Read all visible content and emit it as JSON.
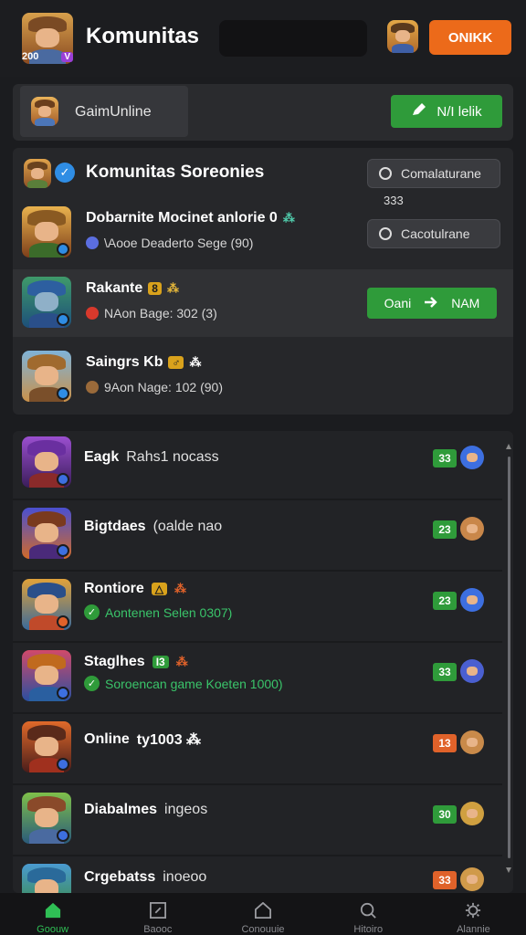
{
  "header": {
    "title": "Komunitas",
    "logo_tag": "200",
    "logo_badge": "V",
    "online_label": "ONIKK"
  },
  "subbar": {
    "label": "GaimUnline",
    "join_label": "N/I lelik"
  },
  "featured": {
    "title": "Komunitas Soreonies",
    "button1": "Comalaturane",
    "between_value": "333",
    "button2": "Cacotulrane",
    "rows": [
      {
        "name": "Dobarnite Mocinet anlorie 0",
        "chip": "",
        "stars": "⁂",
        "stars_color": "teal",
        "sub": "\\Aooe Deaderto Sege (90)",
        "highlighted": false
      },
      {
        "name": "Rakante",
        "chip": "8",
        "stars": "⁂",
        "stars_color": "gold",
        "sub": "NAon Bage: 302 (3)",
        "highlighted": true,
        "cta": "Oani",
        "cta_right": "NAM"
      },
      {
        "name": "Saingrs Kb",
        "chip": "♂",
        "stars": "⁂",
        "stars_color": "white",
        "sub": "9Aon Nage: 102 (90)",
        "highlighted": false
      }
    ]
  },
  "list": {
    "rows": [
      {
        "name": "Eagk",
        "rest": "Rahs1 nocass",
        "sub": "",
        "count": "33",
        "count_color": "#2f9b3a"
      },
      {
        "name": "Bigtdaes",
        "rest": "(oalde nao",
        "sub": "",
        "count": "23",
        "count_color": "#2f9b3a"
      },
      {
        "name": "Rontiore",
        "rest": "",
        "chip": "△",
        "stars": "⁂",
        "sub": "Aontenen Selen 0307)",
        "count": "23",
        "count_color": "#2f9b3a"
      },
      {
        "name": "Staglhes",
        "rest": "",
        "chip": "I3",
        "stars": "⁂",
        "sub": "Soroencan game Koeten 1000)",
        "count": "33",
        "count_color": "#2f9b3a"
      },
      {
        "name": "Online",
        "rest": "ty1003 ⁂",
        "sub": "",
        "count": "13",
        "count_color": "#e0622a"
      },
      {
        "name": "Diabalmes",
        "rest": "ingeos",
        "sub": "",
        "count": "30",
        "count_color": "#2f9b3a"
      },
      {
        "name": "Crgebatss",
        "rest": "inoeoo",
        "sub": "",
        "count": "33",
        "count_color": "#e0622a"
      }
    ]
  },
  "nav": [
    {
      "label": "Goouw",
      "icon": "home-icon",
      "active": true
    },
    {
      "label": "Baooc",
      "icon": "square-icon",
      "active": false
    },
    {
      "label": "Conouuie",
      "icon": "house-outline-icon",
      "active": false
    },
    {
      "label": "Hitoiro",
      "icon": "search-icon",
      "active": false
    },
    {
      "label": "Alannie",
      "icon": "gear-icon",
      "active": false
    }
  ]
}
